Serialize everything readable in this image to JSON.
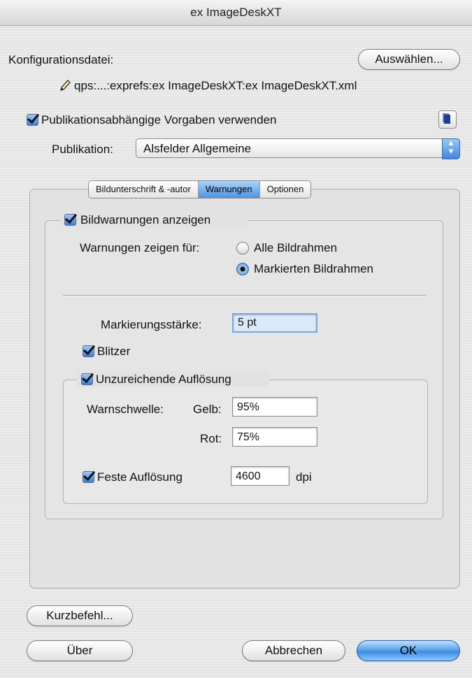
{
  "window": {
    "title": "ex ImageDeskXT"
  },
  "config": {
    "label": "Konfigurationsdatei:",
    "choose_button": "Auswählen...",
    "path": "qps:...:exprefs:ex ImageDeskXT:ex ImageDeskXT.xml",
    "path_icon": "pencil-icon"
  },
  "pub_defaults": {
    "label": "Publikationsabhängige Vorgaben verwenden",
    "checked": true,
    "copy_icon": "copy-icon"
  },
  "publication": {
    "label": "Publikation:",
    "selected": "Alsfelder Allgemeine"
  },
  "tabs": [
    {
      "label": "Bildunterschrift & -autor",
      "active": false
    },
    {
      "label": "Warnungen",
      "active": true
    },
    {
      "label": "Optionen",
      "active": false
    }
  ],
  "warnings": {
    "show_label": "Bildwarnungen anzeigen",
    "show_checked": true,
    "show_for_label": "Warnungen zeigen für:",
    "radio_all": "Alle Bildrahmen",
    "radio_marked": "Markierten Bildrahmen",
    "radio_selected": "marked",
    "marker_label": "Markierungsstärke:",
    "marker_value": "5 pt",
    "flash_label": "Blitzer",
    "flash_checked": true,
    "lowres_label": "Unzureichende Auflösung",
    "lowres_checked": true,
    "threshold_label": "Warnschwelle:",
    "yellow_label": "Gelb:",
    "yellow_value": "95%",
    "red_label": "Rot:",
    "red_value": "75%",
    "fixed_label": "Feste Auflösung",
    "fixed_checked": true,
    "fixed_value": "4600",
    "fixed_unit": "dpi"
  },
  "buttons": {
    "shortcut": "Kurzbefehl...",
    "about": "Über",
    "cancel": "Abbrechen",
    "ok": "OK"
  }
}
